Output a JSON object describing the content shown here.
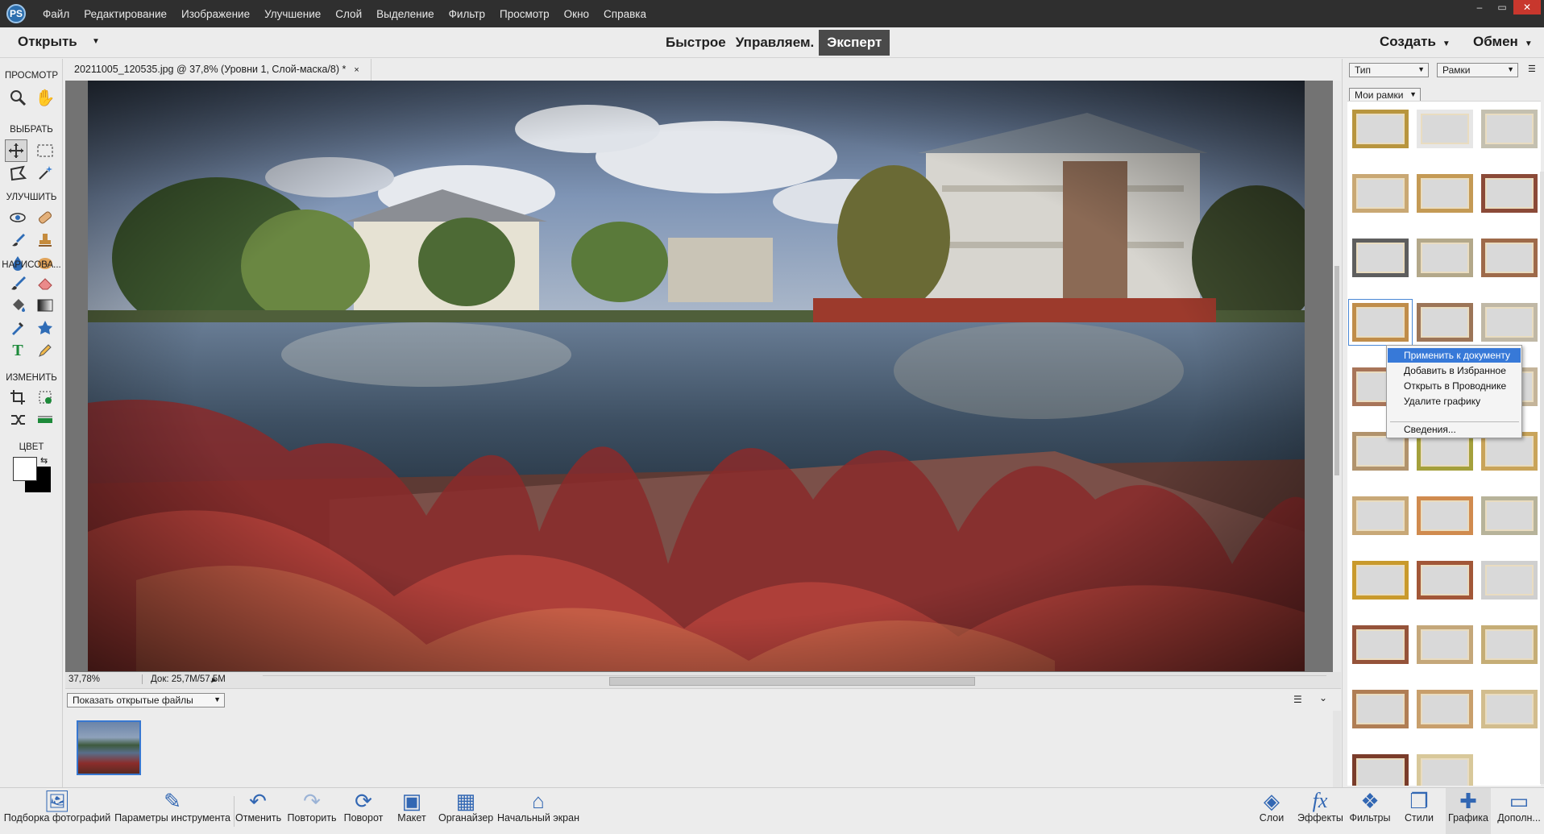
{
  "menubar": {
    "logo": "PS",
    "items": [
      "Файл",
      "Редактирование",
      "Изображение",
      "Улучшение",
      "Слой",
      "Выделение",
      "Фильтр",
      "Просмотр",
      "Окно",
      "Справка"
    ],
    "window_buttons": [
      "–",
      "▭",
      "✕"
    ]
  },
  "modebar": {
    "open_label": "Открыть",
    "modes": [
      "Быстрое",
      "Управляем.",
      "Эксперт"
    ],
    "active_mode": "Эксперт",
    "create_label": "Создать",
    "share_label": "Обмен"
  },
  "toolbox": {
    "sections": [
      "ПРОСМОТР",
      "ВЫБРАТЬ",
      "УЛУЧШИТЬ",
      "НАРИСОВА...",
      "ИЗМЕНИТЬ",
      "ЦВЕТ"
    ]
  },
  "document": {
    "tab_title": "20211005_120535.jpg @ 37,8% (Уровни 1, Слой-маска/8) *",
    "close_glyph": "×",
    "zoom": "37,78%",
    "doc_size": "Док: 25,7M/57,5M"
  },
  "photo_bin": {
    "select_value": "Показать открытые файлы"
  },
  "graphics_panel": {
    "type_select": "Тип",
    "category_select": "Рамки",
    "collection_select": "Мои рамки",
    "frame_colors": [
      "#b8953e",
      "#e6e6e6",
      "#c4c0b0",
      "#c9a874",
      "#c49a55",
      "#8b4a38",
      "#5e5e5e",
      "#b3a88a",
      "#9e6a4a",
      "#c08d4a",
      "#9c7558",
      "#c0b8a6",
      "#a87559",
      "#cba86a",
      "#c4b49a",
      "#b1936d",
      "#a4a03c",
      "#c9a45a",
      "#c8a877",
      "#d08b4f",
      "#b7b39a",
      "#c99a2c",
      "#a25738",
      "#cfcfcf",
      "#95533a",
      "#c4a77a",
      "#c5ad76",
      "#b07e55",
      "#c89f6c",
      "#d2bd8e",
      "#7a3c2a",
      "#d8c89a"
    ]
  },
  "context_menu": {
    "items": [
      "Применить к документу",
      "Добавить в Избранное",
      "Открыть в Проводнике",
      "Удалите графику",
      "Сведения..."
    ],
    "highlighted": "Применить к документу"
  },
  "bottombar": {
    "left": [
      {
        "label": "Подборка фотографий",
        "icon": "photo-bin-icon"
      },
      {
        "label": "Параметры инструмента",
        "icon": "tool-options-icon"
      },
      {
        "label": "Отменить",
        "icon": "undo-icon"
      },
      {
        "label": "Повторить",
        "icon": "redo-icon"
      },
      {
        "label": "Поворот",
        "icon": "rotate-icon"
      },
      {
        "label": "Макет",
        "icon": "layout-icon"
      },
      {
        "label": "Органайзер",
        "icon": "organizer-icon"
      },
      {
        "label": "Начальный экран",
        "icon": "home-icon"
      }
    ],
    "right": [
      {
        "label": "Слои",
        "icon": "layers-icon"
      },
      {
        "label": "Эффекты",
        "icon": "effects-icon"
      },
      {
        "label": "Фильтры",
        "icon": "filters-icon"
      },
      {
        "label": "Стили",
        "icon": "styles-icon"
      },
      {
        "label": "Графика",
        "icon": "graphics-icon"
      },
      {
        "label": "Дополн...",
        "icon": "more-icon"
      }
    ]
  }
}
